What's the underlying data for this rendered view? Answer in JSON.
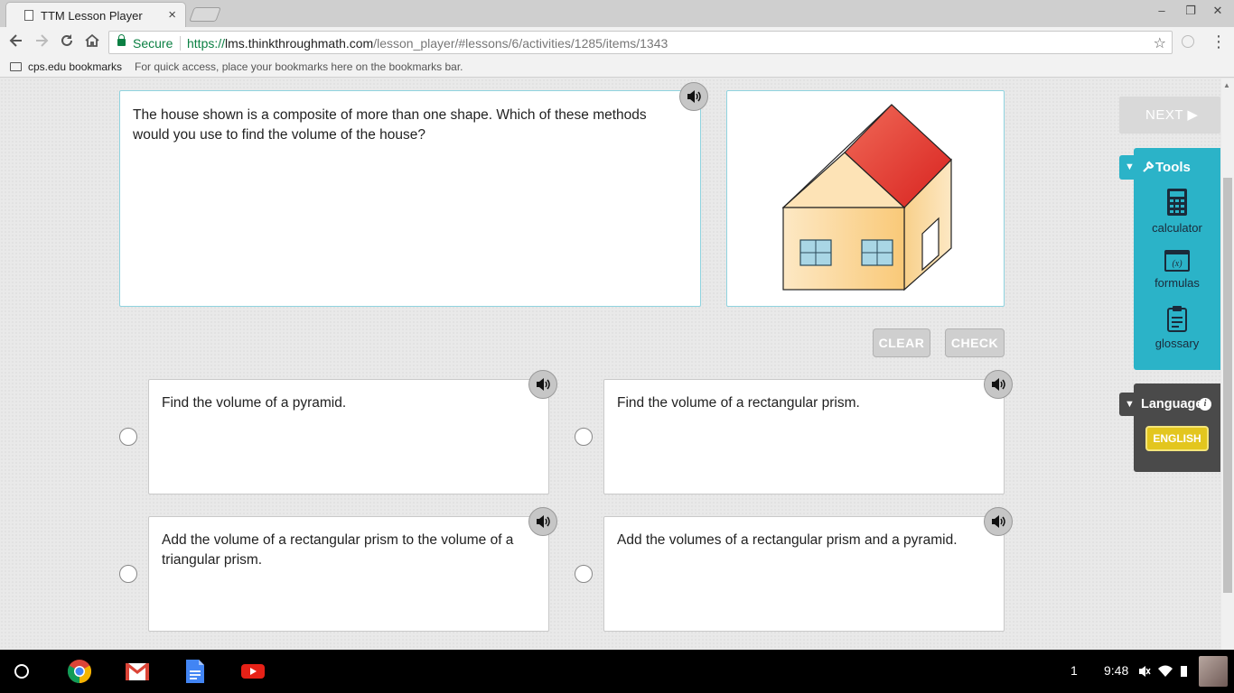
{
  "browser": {
    "tab_title": "TTM Lesson Player",
    "tab_close": "×",
    "window_controls": [
      "–",
      "❐",
      "✕"
    ],
    "nav_icons": [
      "back-icon",
      "forward-icon",
      "reload-icon",
      "home-icon"
    ],
    "secure_label": "Secure",
    "url_scheme": "https://",
    "url_host": "lms.thinkthroughmath.com",
    "url_path": "/lesson_player/#lessons/6/activities/1285/items/1343",
    "bookmark_folder": "cps.edu bookmarks",
    "bookmark_hint": "For quick access, place your bookmarks here on the bookmarks bar."
  },
  "question": {
    "text": "The house shown is a composite of more than one shape. Which of these methods would you use to find the volume of the house?"
  },
  "actions": {
    "clear_label": "CLEAR",
    "check_label": "CHECK",
    "next_label": "NEXT ▶"
  },
  "answers": [
    {
      "text": "Find the volume of a pyramid."
    },
    {
      "text": "Find the volume of a rectangular prism."
    },
    {
      "text": "Add the volume of a rectangular prism to the volume of a triangular prism."
    },
    {
      "text": "Add the volumes of a rectangular prism and a pyramid."
    }
  ],
  "tools": {
    "title": "Tools",
    "items": [
      {
        "label": "calculator",
        "icon": "calculator-icon"
      },
      {
        "label": "formulas",
        "icon": "formulas-icon"
      },
      {
        "label": "glossary",
        "icon": "glossary-icon"
      }
    ]
  },
  "language": {
    "title": "Language",
    "info": "i",
    "selected": "ENGLISH"
  },
  "shelf": {
    "notification_count": "1",
    "time": "9:48"
  },
  "colors": {
    "accent_teal": "#2bb3c8",
    "english_yellow": "#e3c61e",
    "roof_red": "#e8403a",
    "wall_beige": "#fbd9a4"
  }
}
